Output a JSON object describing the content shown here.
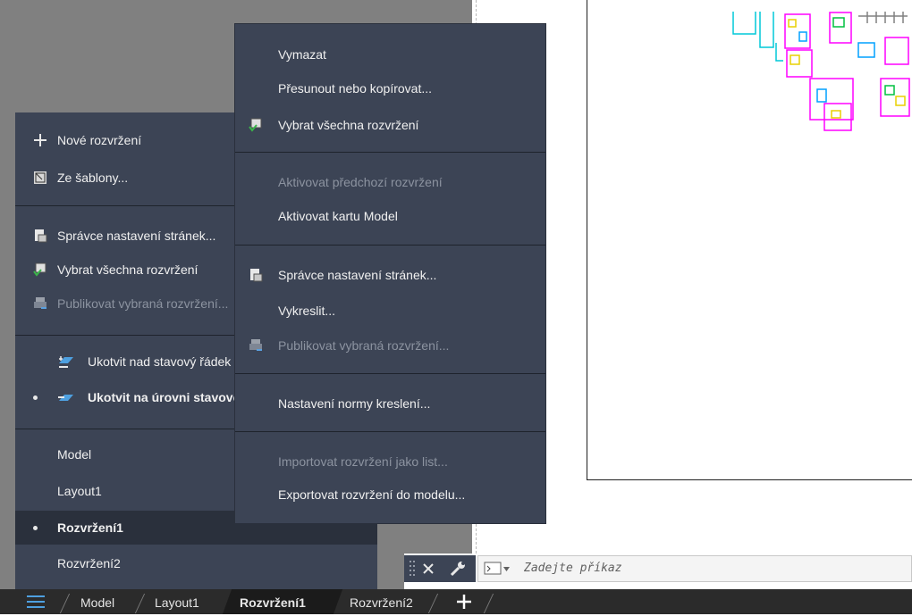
{
  "left_menu": {
    "items": [
      {
        "label": "Nové rozvržení",
        "icon": "plus-icon",
        "disabled": false
      },
      {
        "label": "Ze šablony...",
        "icon": "template-icon",
        "disabled": false
      },
      {
        "label": "Správce nastavení stránek...",
        "icon": "page-setup-icon",
        "disabled": false
      },
      {
        "label": "Vybrat všechna rozvržení",
        "icon": "select-all-layouts-icon",
        "disabled": false
      },
      {
        "label": "Publikovat vybraná rozvržení...",
        "icon": "publish-icon",
        "disabled": true
      },
      {
        "label": "Ukotvit nad stavový řádek",
        "icon": "dock-above-icon",
        "disabled": false
      },
      {
        "label": "Ukotvit na úrovni stavového řádku",
        "icon": "dock-inline-icon",
        "disabled": false,
        "checked": true
      },
      {
        "label": "Model",
        "disabled": false
      },
      {
        "label": "Layout1",
        "disabled": false
      },
      {
        "label": "Rozvržení1",
        "disabled": false,
        "checked": true
      },
      {
        "label": "Rozvržení2",
        "disabled": false
      }
    ]
  },
  "context_menu": {
    "items": [
      {
        "label": "Vymazat",
        "disabled": false
      },
      {
        "label": "Přesunout nebo kopírovat...",
        "disabled": false
      },
      {
        "label": "Vybrat všechna rozvržení",
        "icon": "select-all-layouts-icon",
        "disabled": false
      },
      {
        "label": "Aktivovat předchozí rozvržení",
        "disabled": true
      },
      {
        "label": "Aktivovat kartu Model",
        "disabled": false
      },
      {
        "label": "Správce nastavení stránek...",
        "icon": "page-setup-icon",
        "disabled": false
      },
      {
        "label": "Vykreslit...",
        "disabled": false
      },
      {
        "label": "Publikovat vybraná rozvržení...",
        "icon": "publish-icon",
        "disabled": true
      },
      {
        "label": "Nastavení normy kreslení...",
        "disabled": false
      },
      {
        "label": "Importovat rozvržení jako list...",
        "disabled": true
      },
      {
        "label": "Exportovat rozvržení do modelu...",
        "disabled": false
      }
    ]
  },
  "command_line": {
    "placeholder": "Zadejte příkaz"
  },
  "status_bar": {
    "tabs": [
      "Model",
      "Layout1",
      "Rozvržení1",
      "Rozvržení2"
    ],
    "active_tab": "Rozvržení1"
  },
  "colors": {
    "menu_bg": "#3c4455",
    "disabled_text": "#8c93a0",
    "statusbar_bg": "#2b2b2b",
    "accent_green": "#3ab54a"
  }
}
